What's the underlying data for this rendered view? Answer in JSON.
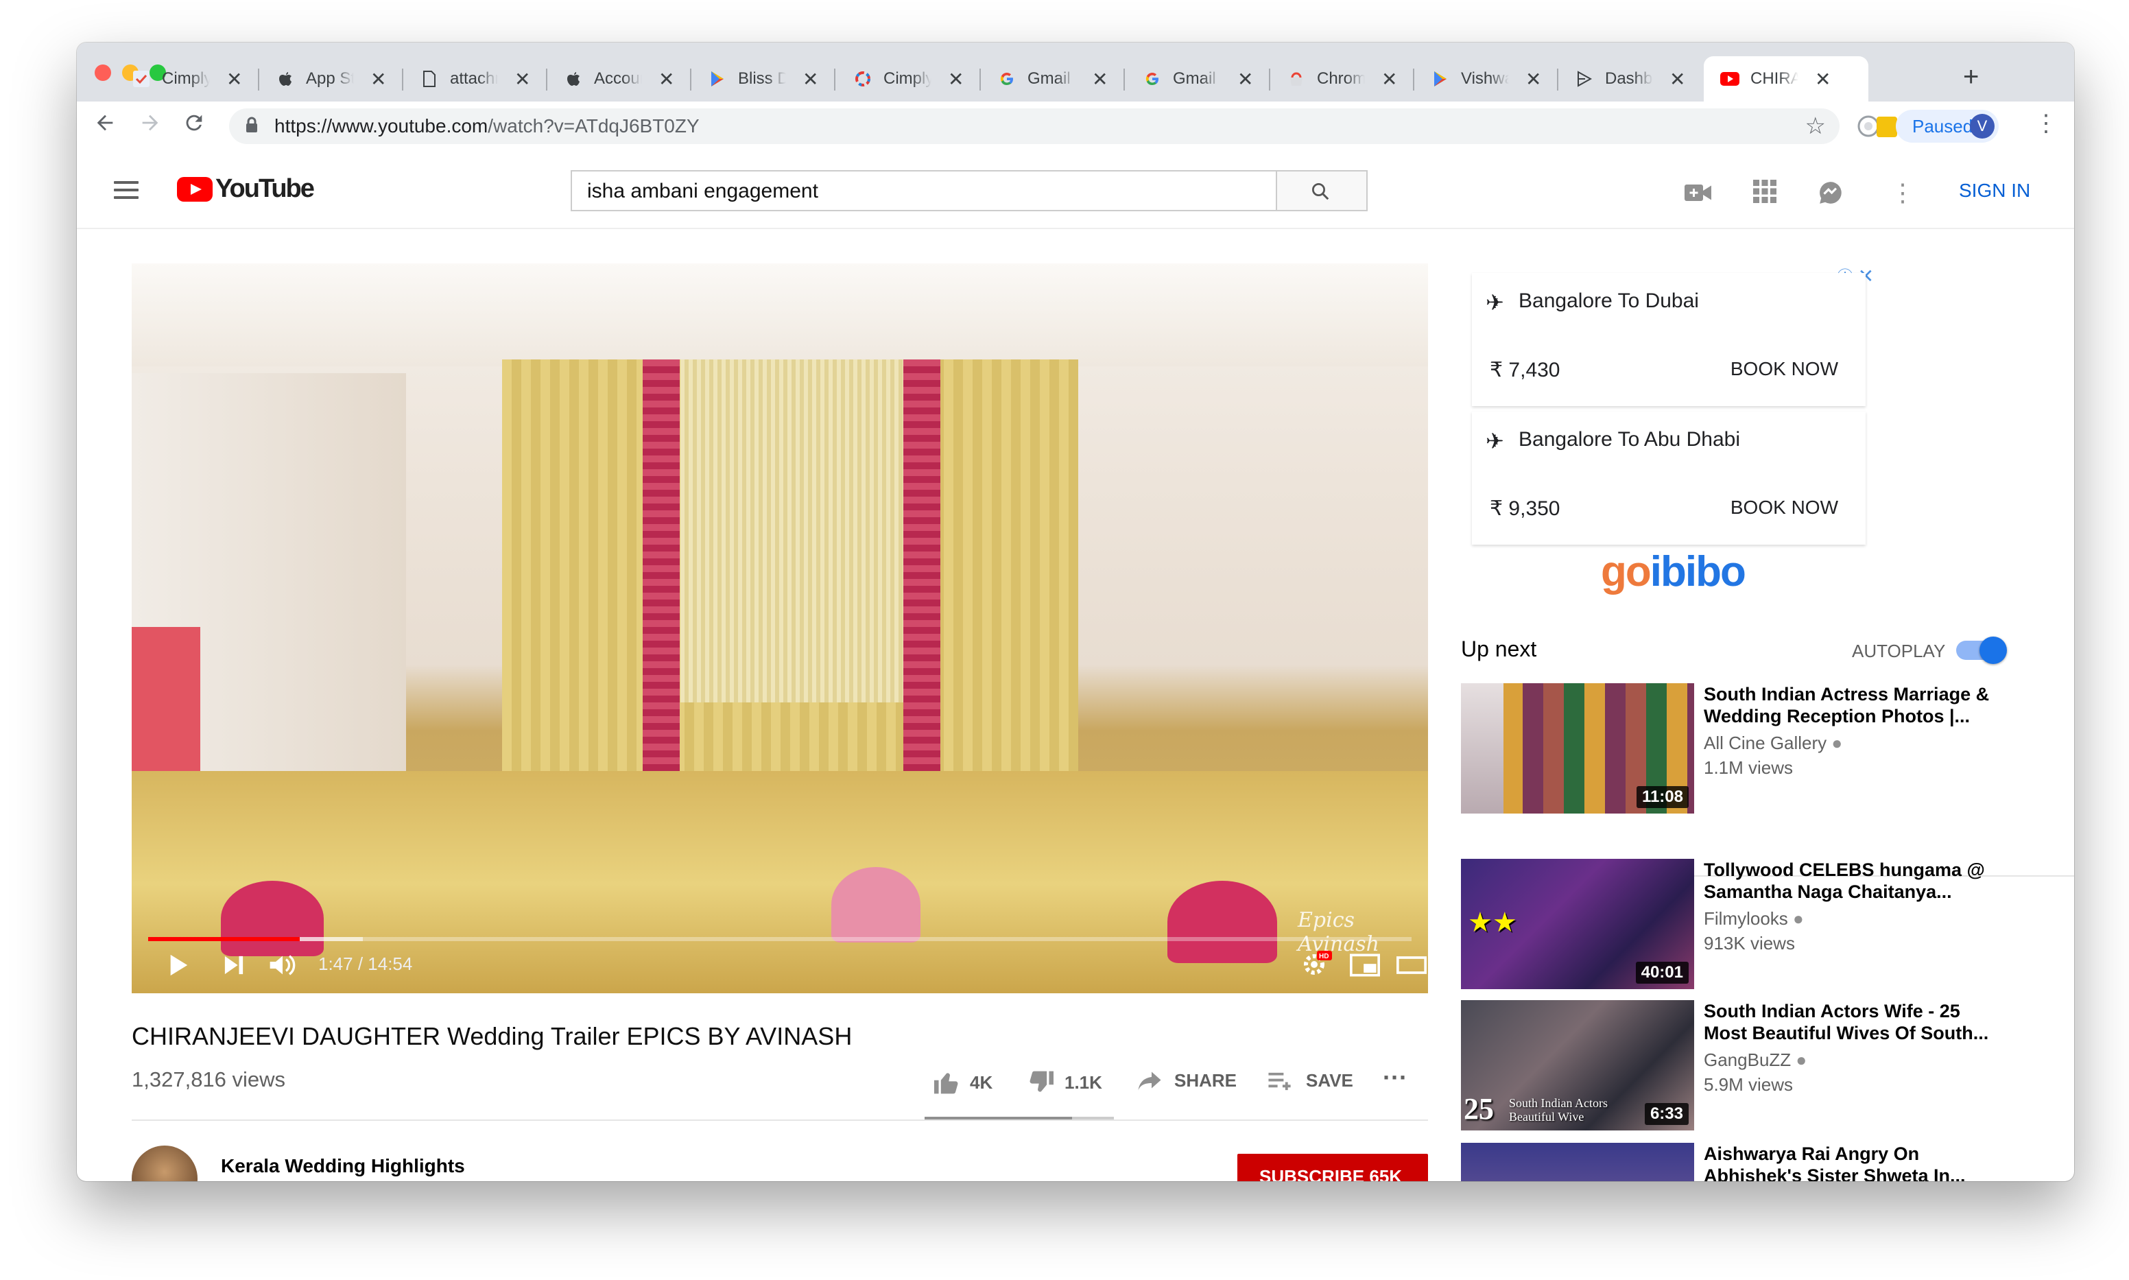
{
  "browser": {
    "tabs": [
      {
        "title": "CimplyFive",
        "icon": "check-icon",
        "active": false
      },
      {
        "title": "App Store",
        "icon": "apple-icon",
        "active": false
      },
      {
        "title": "attachment",
        "icon": "document-icon",
        "active": false
      },
      {
        "title": "Account",
        "icon": "apple-icon",
        "active": false
      },
      {
        "title": "Bliss Drive",
        "icon": "play-store-icon",
        "active": false
      },
      {
        "title": "CimplyFive",
        "icon": "cimplyfive-icon",
        "active": false
      },
      {
        "title": "Gmail",
        "icon": "google-icon",
        "active": false
      },
      {
        "title": "Gmail",
        "icon": "google-icon",
        "active": false
      },
      {
        "title": "Chrome",
        "icon": "chrome-webstore-icon",
        "active": false
      },
      {
        "title": "Vishwa",
        "icon": "play-store-icon",
        "active": false
      },
      {
        "title": "Dashboard",
        "icon": "play-console-icon",
        "active": false
      },
      {
        "title": "CHIRANJEEVI",
        "icon": "youtube-icon",
        "active": true
      }
    ],
    "new_tab": "+",
    "url_host": "https://www.youtube.com",
    "url_path": "/watch?v=ATdqJ6BT0ZY",
    "profile_status": "Paused",
    "profile_initial": "V"
  },
  "youtube": {
    "logo_text": "YouTube",
    "search_query": "isha ambani engagement",
    "sign_in": "SIGN IN"
  },
  "player": {
    "current_time": "1:47",
    "duration": "14:54",
    "time_display": "1:47 / 14:54",
    "played_fraction": 0.12,
    "loaded_fraction": 0.17,
    "watermark": "Epics Avinash"
  },
  "video": {
    "title": "CHIRANJEEVI DAUGHTER Wedding Trailer EPICS BY AVINASH",
    "views": "1,327,816 views",
    "likes": "4K",
    "dislikes": "1.1K",
    "share_label": "SHARE",
    "save_label": "SAVE",
    "like_ratio": 0.78,
    "channel_name": "Kerala Wedding Highlights",
    "subscribe_label": "SUBSCRIBE 65K"
  },
  "ad": {
    "cards": [
      {
        "route": "Bangalore To Dubai",
        "price": "₹ 7,430",
        "cta": "BOOK NOW"
      },
      {
        "route": "Bangalore To Abu Dhabi",
        "price": "₹ 9,350",
        "cta": "BOOK NOW"
      }
    ],
    "brand": "goibibo",
    "brand_colors": {
      "go": "#ee7a3c",
      "ibibo": "#2276e3"
    }
  },
  "up_next": {
    "heading": "Up next",
    "autoplay_label": "AUTOPLAY",
    "autoplay_on": true,
    "items": [
      {
        "title": "South Indian Actress Marriage & Wedding Reception Photos |...",
        "channel": "All Cine Gallery",
        "views": "1.1M views",
        "duration": "11:08"
      },
      {
        "title": "Tollywood CELEBS hungama @ Samantha Naga Chaitanya...",
        "channel": "Filmylooks",
        "views": "913K views",
        "duration": "40:01"
      },
      {
        "title": "South Indian Actors Wife - 25 Most Beautiful Wives Of South...",
        "channel": "GangBuZZ",
        "views": "5.9M views",
        "duration": "6:33",
        "thumb_text": "South Indian Actors Beautiful Wive",
        "thumb_num": "25"
      },
      {
        "title": "Aishwarya Rai Angry On Abhishek's Sister Shweta In...",
        "channel": "",
        "views": "",
        "duration": ""
      }
    ]
  },
  "colors": {
    "youtube_red": "#ff0000",
    "link_blue": "#065fd4",
    "subscribe_red": "#cc0000"
  }
}
